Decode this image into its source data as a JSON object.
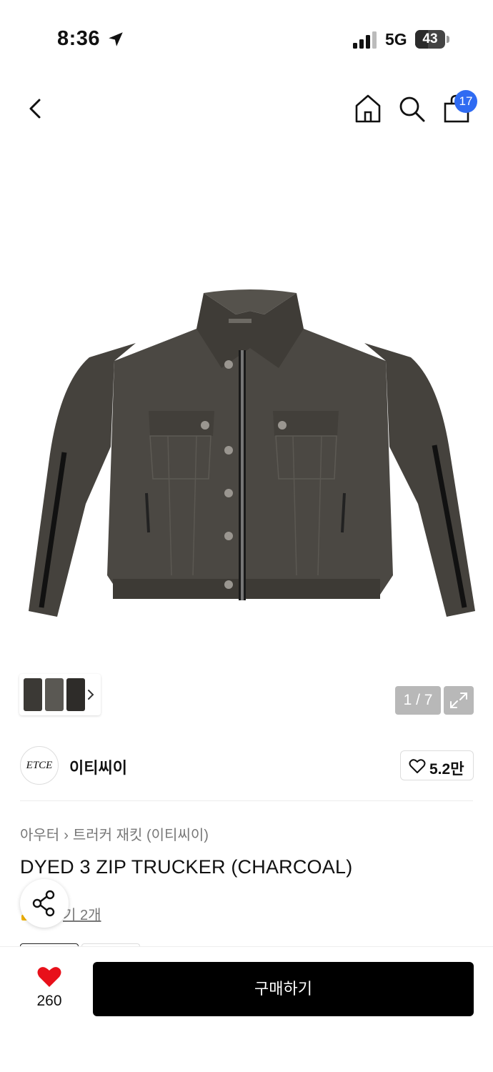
{
  "status_bar": {
    "time": "8:36",
    "network": "5G",
    "battery": "43",
    "battery_level": 0.43
  },
  "nav": {
    "icons": [
      "back-icon",
      "home-icon",
      "search-icon",
      "shopping-bag-icon"
    ],
    "cart_count": "17"
  },
  "gallery": {
    "counter": "1 / 7",
    "image_description": "charcoal dyed trucker jacket with three zips"
  },
  "brand": {
    "logo_text": "ETCE",
    "name": "이티씨이",
    "likes": "5.2만"
  },
  "product": {
    "breadcrumb": [
      "아우터",
      "트러커 재킷 (이티씨이)"
    ],
    "title": "DYED 3 ZIP TRUCKER (CHARCOAL)",
    "review_text": "기 2개"
  },
  "bottom_bar": {
    "wish_count": "260",
    "buy_label": "구매하기"
  },
  "colors": {
    "accent_badge": "#2f6bf2",
    "heart": "#e8101a",
    "buy_button": "#000000"
  }
}
